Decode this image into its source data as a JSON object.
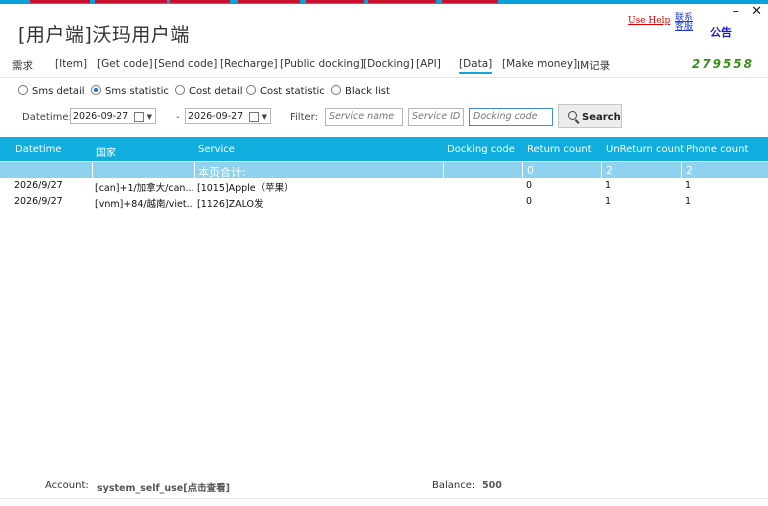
{
  "app": {
    "title": "[用户端]沃玛用户端",
    "links": {
      "help": "Use Help",
      "contact": "联系客服",
      "notice": "公告"
    },
    "window": {
      "minimize": "–",
      "close": "✕"
    }
  },
  "nav": {
    "items": [
      "需求",
      "[Item]",
      "[Get code]",
      "[Send code]",
      "[Recharge]",
      "[Public docking]",
      "[Docking]",
      "[API]",
      "[Data]",
      "[Make money]",
      "IM记录"
    ],
    "active": "[Data]",
    "code": "279558"
  },
  "radios": {
    "options": [
      "Sms detail",
      "Sms statistic",
      "Cost detail",
      "Cost statistic",
      "Black list"
    ],
    "selected": "Sms statistic"
  },
  "filter": {
    "datetime_label": "Datetime:",
    "date_from": "2026-09-27",
    "dash": "-",
    "date_to": "2026-09-27",
    "filter_label": "Filter:",
    "service_name_placeholder": "Service name",
    "service_id_placeholder": "Service ID",
    "docking_code_placeholder": "Docking code",
    "search_label": "Search"
  },
  "table": {
    "columns": [
      "Datetime",
      "国家",
      "Service",
      "Docking code",
      "Return count",
      "UnReturn count",
      "Phone count"
    ],
    "summary": {
      "label": "本页合计:",
      "return": "0",
      "unreturn": "2",
      "phone": "2"
    },
    "rows": [
      {
        "datetime": "2026/9/27",
        "country": "[can]+1/加拿大/can...",
        "service": "[1015]Apple（苹果）",
        "docking": "",
        "return": "0",
        "unreturn": "1",
        "phone": "1"
      },
      {
        "datetime": "2026/9/27",
        "country": "[vnm]+84/越南/viet...",
        "service": "[1126]ZALO发",
        "docking": "",
        "return": "0",
        "unreturn": "1",
        "phone": "1"
      }
    ]
  },
  "footer": {
    "account_label": "Account:",
    "account_value": "system_self_use[点击查看]",
    "balance_label": "Balance:",
    "balance_value": "500"
  },
  "colors": {
    "accent": "#10aede",
    "summary": "#8ed2ef",
    "code": "#3a8f1a",
    "link_red": "#dd0000",
    "top_red": "#c8102e"
  }
}
